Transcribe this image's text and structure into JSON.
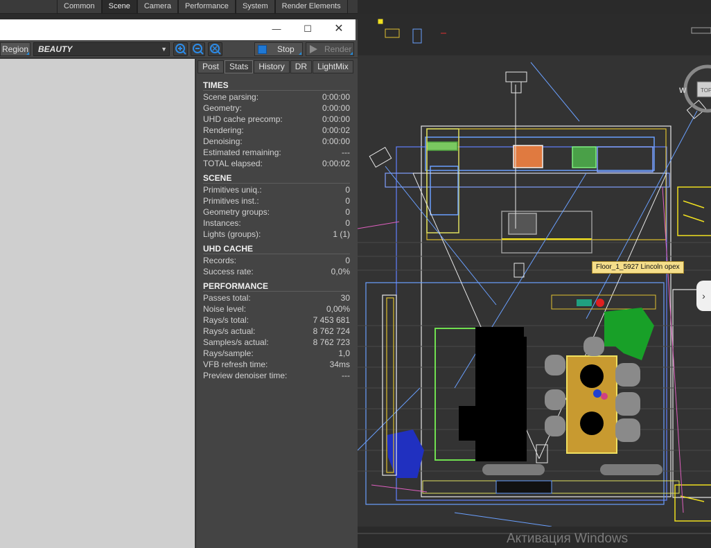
{
  "render_tabs": [
    "Common",
    "Scene",
    "Camera",
    "Performance",
    "System",
    "Render Elements"
  ],
  "render_tabs_active": "Scene",
  "vfb": {
    "region_label": "Region",
    "channel": "BEAUTY",
    "stop_label": "Stop",
    "render_label": "Render",
    "panel_tabs": [
      "Post",
      "Stats",
      "History",
      "DR",
      "LightMix"
    ],
    "panel_tabs_active": "Stats",
    "sections": [
      {
        "title": "TIMES",
        "rows": [
          {
            "label": "Scene parsing:",
            "value": "0:00:00"
          },
          {
            "label": "Geometry:",
            "value": "0:00:00"
          },
          {
            "label": "UHD cache precomp:",
            "value": "0:00:00"
          },
          {
            "label": "Rendering:",
            "value": "0:00:02"
          },
          {
            "label": "Denoising:",
            "value": "0:00:00"
          },
          {
            "label": "Estimated remaining:",
            "value": "---"
          },
          {
            "label": "TOTAL elapsed:",
            "value": "0:00:02"
          }
        ]
      },
      {
        "title": "SCENE",
        "rows": [
          {
            "label": "Primitives uniq.:",
            "value": "0"
          },
          {
            "label": "Primitives inst.:",
            "value": "0"
          },
          {
            "label": "Geometry groups:",
            "value": "0"
          },
          {
            "label": "Instances:",
            "value": "0"
          },
          {
            "label": "Lights (groups):",
            "value": "1 (1)"
          }
        ]
      },
      {
        "title": "UHD CACHE",
        "rows": [
          {
            "label": "Records:",
            "value": "0"
          },
          {
            "label": "Success rate:",
            "value": "0,0%"
          }
        ]
      },
      {
        "title": "PERFORMANCE",
        "rows": [
          {
            "label": "Passes total:",
            "value": "30"
          },
          {
            "label": "Noise level:",
            "value": "0,00%"
          },
          {
            "label": "Rays/s total:",
            "value": "7 453 681"
          },
          {
            "label": "Rays/s actual:",
            "value": "8 762 724"
          },
          {
            "label": "Samples/s actual:",
            "value": "8 762 723"
          },
          {
            "label": "Rays/sample:",
            "value": "1,0"
          },
          {
            "label": "VFB refresh time:",
            "value": "34ms"
          },
          {
            "label": "Preview denoiser time:",
            "value": "---"
          }
        ]
      }
    ]
  },
  "viewport": {
    "tooltip": "Floor_1_5927 Lincoln opex",
    "compass_labels": [
      "W",
      "TOP"
    ],
    "watermark": "Активация Windows"
  },
  "colors": {
    "accent_blue": "#1f78d4",
    "tooltip_bg": "#f5de8a"
  }
}
